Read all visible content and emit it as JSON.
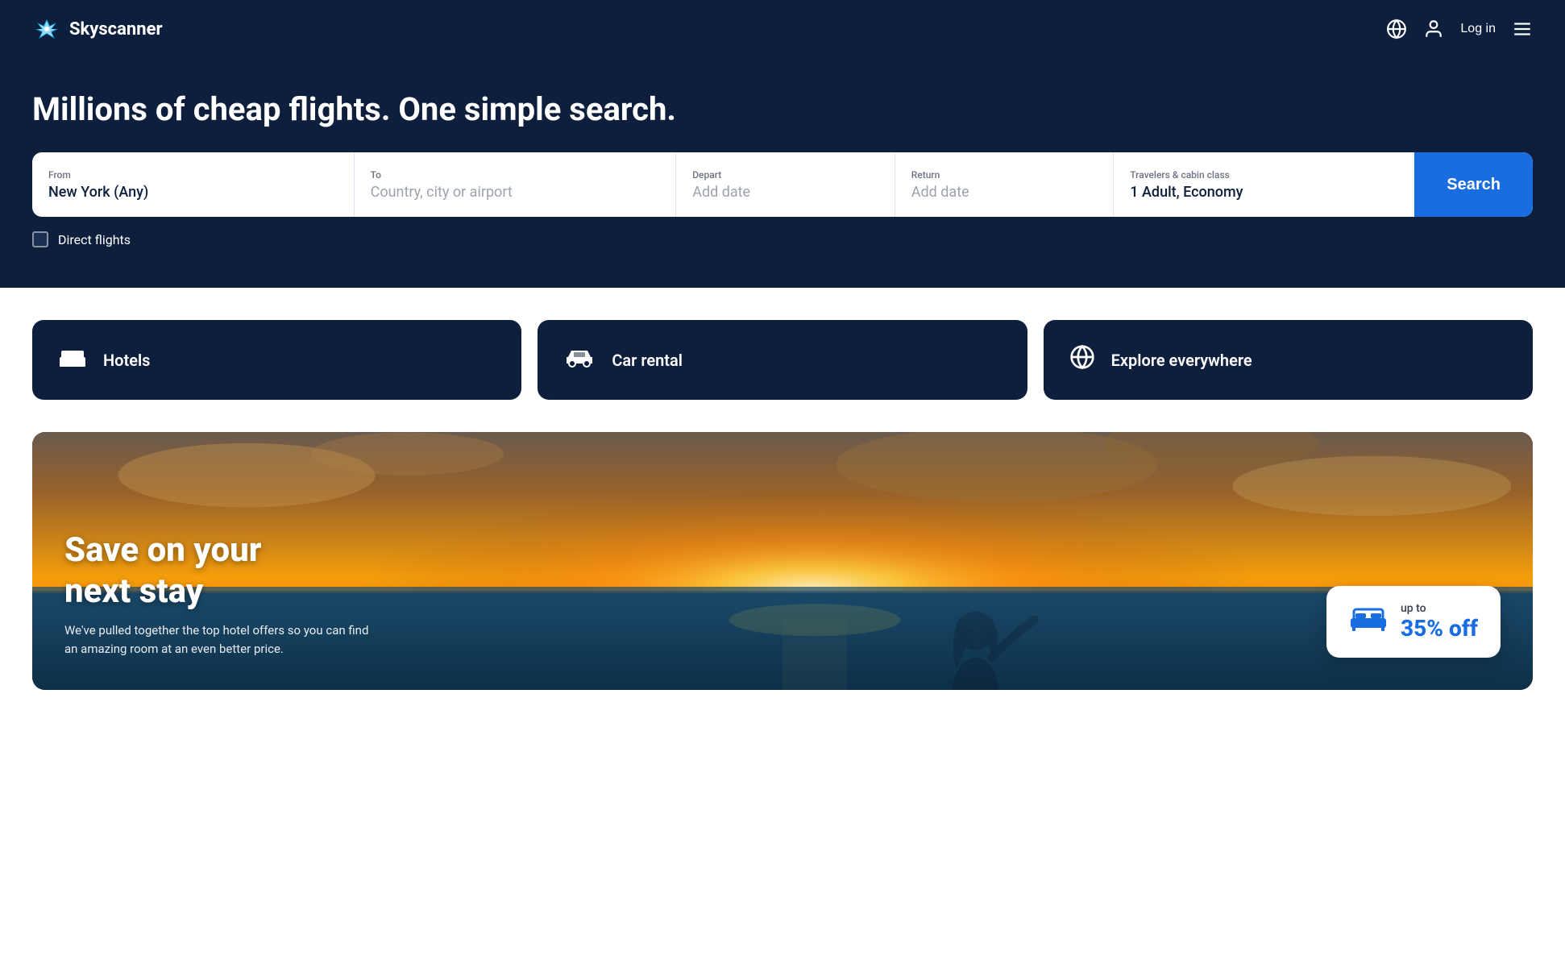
{
  "header": {
    "logo_text": "Skyscanner",
    "login_label": "Log in"
  },
  "hero": {
    "title": "Millions of cheap flights. One simple search.",
    "search": {
      "from_label": "From",
      "from_value": "New York (Any)",
      "to_label": "To",
      "to_placeholder": "Country, city or airport",
      "depart_label": "Depart",
      "depart_placeholder": "Add date",
      "return_label": "Return",
      "return_placeholder": "Add date",
      "travelers_label": "Travelers & cabin class",
      "travelers_value": "1 Adult, Economy",
      "search_button": "Search"
    },
    "direct_flights_label": "Direct flights"
  },
  "services": {
    "hotels_label": "Hotels",
    "car_rental_label": "Car rental",
    "explore_label": "Explore everywhere"
  },
  "hotel_promo": {
    "heading_line1": "Save on your",
    "heading_line2": "next stay",
    "subtext": "We've pulled together the top hotel offers so you can find an amazing room at an even better price.",
    "badge_prefix": "up to",
    "badge_discount": "35% off"
  }
}
